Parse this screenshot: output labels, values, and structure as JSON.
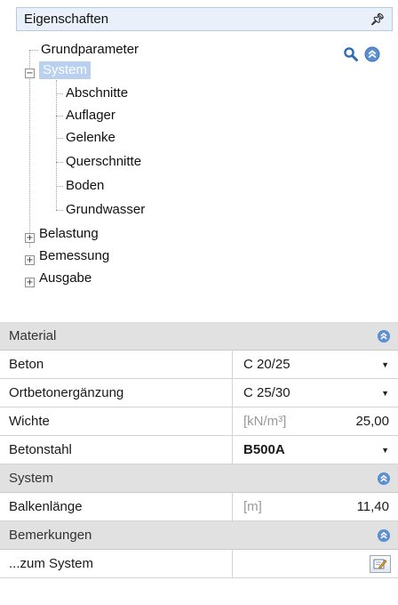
{
  "panel": {
    "title": "Eigenschaften"
  },
  "tree": {
    "grundparameter": "Grundparameter",
    "system": "System",
    "system_children": [
      "Abschnitte",
      "Auflager",
      "Gelenke",
      "Querschnitte",
      "Boden",
      "Grundwasser"
    ],
    "belastung": "Belastung",
    "bemessung": "Bemessung",
    "ausgabe": "Ausgabe"
  },
  "icons": {
    "search": "search-icon",
    "collapse": "collapse-icon",
    "pin": "pin-icon",
    "edit": "edit-icon"
  },
  "grid": {
    "material": {
      "label": "Material",
      "rows": [
        {
          "name": "Beton",
          "value": "C 20/25"
        },
        {
          "name": "Ortbetonergänzung",
          "value": "C 25/30"
        },
        {
          "name": "Wichte",
          "unit": "[kN/m³]",
          "value": "25,00"
        },
        {
          "name": "Betonstahl",
          "value": "B500A"
        }
      ]
    },
    "system": {
      "label": "System",
      "rows": [
        {
          "name": "Balkenlänge",
          "unit": "[m]",
          "value": "11,40"
        }
      ]
    },
    "bemerkungen": {
      "label": "Bemerkungen",
      "rows": [
        {
          "name": "...zum System"
        }
      ]
    }
  },
  "colors": {
    "accent": "#4f86c6",
    "selection": "#b9d1ef",
    "section_bg": "#e1e1e1"
  }
}
